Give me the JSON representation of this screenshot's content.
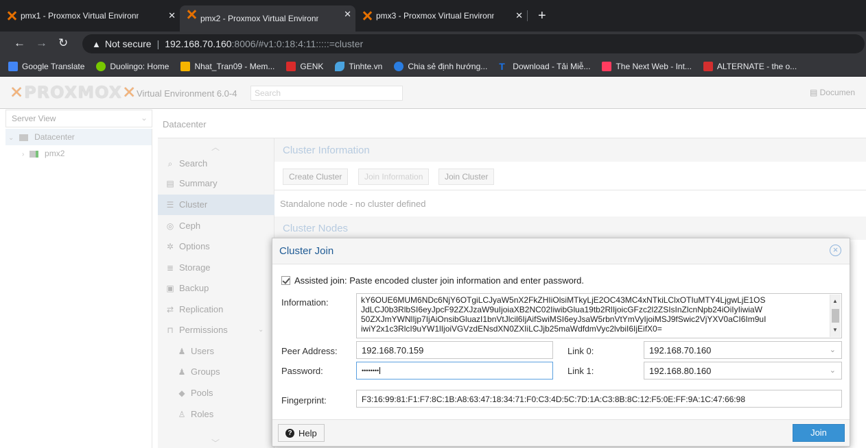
{
  "browser": {
    "tabs": [
      {
        "title": "pmx1 - Proxmox Virtual Environm"
      },
      {
        "title": "pmx2 - Proxmox Virtual Environm"
      },
      {
        "title": "pmx3 - Proxmox Virtual Environm"
      }
    ],
    "address": {
      "security": "Not secure",
      "host": "192.168.70.160",
      "rest": ":8006/#v1:0:18:4:11:::::=cluster"
    },
    "bookmarks": [
      {
        "label": "Google Translate",
        "color": "#4285f4"
      },
      {
        "label": "Duolingo: Home",
        "color": "#78c800"
      },
      {
        "label": "Nhat_Tran09 - Mem...",
        "color": "#f5b400"
      },
      {
        "label": "GENK",
        "color": "#d92b2b"
      },
      {
        "label": "Tinhte.vn",
        "color": "#4aa3df"
      },
      {
        "label": "Chia sẻ định hướng...",
        "color": "#2a7de1"
      },
      {
        "label": "Download - Tải Miễ...",
        "color": "#1a73e8"
      },
      {
        "label": "The Next Web - Int...",
        "color": "#ff3c5f"
      },
      {
        "label": "ALTERNATE - the o...",
        "color": "#d32f2f"
      }
    ]
  },
  "pve": {
    "logo": "PROXMOX",
    "version": "Virtual Environment 6.0-4",
    "search_placeholder": "Search",
    "docs": "Documen",
    "server_view": "Server View",
    "tree": [
      {
        "label": "Datacenter"
      },
      {
        "label": "pmx2"
      }
    ],
    "content_title": "Datacenter",
    "menu": [
      {
        "label": "Search",
        "icon": "search-icon"
      },
      {
        "label": "Summary",
        "icon": "book-icon"
      },
      {
        "label": "Cluster",
        "icon": "server-icon"
      },
      {
        "label": "Ceph",
        "icon": "ceph-icon"
      },
      {
        "label": "Options",
        "icon": "gear-icon"
      },
      {
        "label": "Storage",
        "icon": "database-icon"
      },
      {
        "label": "Backup",
        "icon": "floppy-icon"
      },
      {
        "label": "Replication",
        "icon": "retweet-icon"
      },
      {
        "label": "Permissions",
        "icon": "unlock-icon"
      },
      {
        "label": "Users",
        "icon": "user-icon"
      },
      {
        "label": "Groups",
        "icon": "users-icon"
      },
      {
        "label": "Pools",
        "icon": "tags-icon"
      },
      {
        "label": "Roles",
        "icon": "male-icon"
      }
    ],
    "cluster_info_title": "Cluster Information",
    "buttons": {
      "create": "Create Cluster",
      "join_info": "Join Information",
      "join": "Join Cluster"
    },
    "standalone": "Standalone node - no cluster defined",
    "cluster_nodes_title": "Cluster Nodes"
  },
  "dialog": {
    "title": "Cluster Join",
    "assisted": "Assisted join: Paste encoded cluster join information and enter password.",
    "labels": {
      "information": "Information:",
      "peer": "Peer Address:",
      "password": "Password:",
      "link0": "Link 0:",
      "link1": "Link 1:",
      "fingerprint": "Fingerprint:"
    },
    "information_lines": [
      "kY6OUE6MUM6NDc6NjY6OTgiLCJyaW5nX2FkZHIiOlsiMTkyLjE2OC43MC4xNTkiLClxOTIuMTY4LjgwLjE1OS",
      "JdLCJ0b3RlbSI6eyJpcF92ZXJzaW9uIjoiaXB2NC02IiwibGlua19tb2RlIjoicGFzc2l2ZSIsInZlcnNpb24iOiIyIiwiaW",
      "50ZXJmYWNlIjp7IjAiOnsibGluazI1bnVtJlcil6IjAifSwiMSI6eyJsaW5rbnVtYmVyIjoiMSJ9fSwic2VjYXV0aCI6Im9uI",
      "iwiY2x1c3RlcI9uYW1lIjoiVGVzdENsdXN0ZXIiLCJjb25maWdfdmVyc2lvbiI6IjEifX0="
    ],
    "peer_address": "192.168.70.159",
    "password": "••••••••",
    "link0": "192.168.70.160",
    "link1": "192.168.80.160",
    "fingerprint": "F3:16:99:81:F1:F7:8C:1B:A8:63:47:18:34:71:F0:C3:4D:5C:7D:1A:C3:8B:8C:12:F5:0E:FF:9A:1C:47:66:98",
    "help": "Help",
    "join": "Join"
  }
}
